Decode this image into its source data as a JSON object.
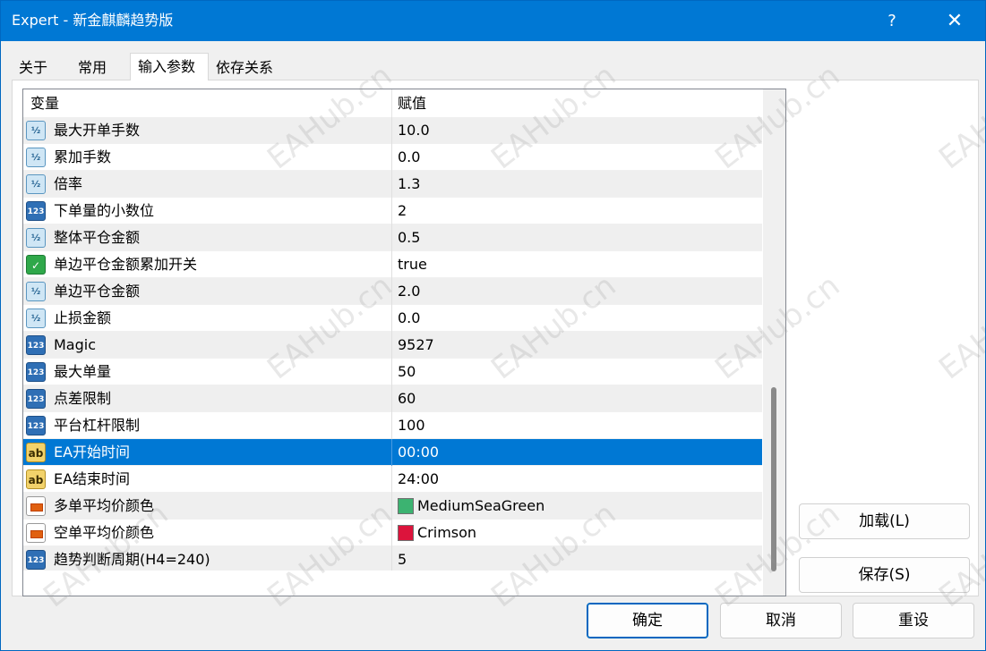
{
  "window": {
    "title": "Expert - 新金麒麟趋势版",
    "help_glyph": "?",
    "close_glyph": "✕"
  },
  "tabs": [
    {
      "label": "关于"
    },
    {
      "label": "常用"
    },
    {
      "label": "输入参数"
    },
    {
      "label": "依存关系"
    }
  ],
  "grid": {
    "header_variable": "变量",
    "header_value": "赋值",
    "rows": [
      {
        "icon": "double-icon",
        "icon_text": "½",
        "name": "最大开单手数",
        "value": "10.0"
      },
      {
        "icon": "double-icon",
        "icon_text": "½",
        "name": "累加手数",
        "value": "0.0"
      },
      {
        "icon": "double-icon",
        "icon_text": "½",
        "name": "倍率",
        "value": "1.3"
      },
      {
        "icon": "integer-icon",
        "icon_text": "123",
        "name": "下单量的小数位",
        "value": "2"
      },
      {
        "icon": "double-icon",
        "icon_text": "½",
        "name": "整体平仓金额",
        "value": "0.5"
      },
      {
        "icon": "bool-icon",
        "icon_text": "✓",
        "name": "单边平仓金额累加开关",
        "value": "true"
      },
      {
        "icon": "double-icon",
        "icon_text": "½",
        "name": "单边平仓金额",
        "value": "2.0"
      },
      {
        "icon": "double-icon",
        "icon_text": "½",
        "name": "止损金额",
        "value": "0.0"
      },
      {
        "icon": "integer-icon",
        "icon_text": "123",
        "name": "Magic",
        "value": "9527"
      },
      {
        "icon": "integer-icon",
        "icon_text": "123",
        "name": "最大单量",
        "value": "50"
      },
      {
        "icon": "integer-icon",
        "icon_text": "123",
        "name": "点差限制",
        "value": "60"
      },
      {
        "icon": "integer-icon",
        "icon_text": "123",
        "name": "平台杠杆限制",
        "value": "100"
      },
      {
        "icon": "string-icon",
        "icon_text": "ab",
        "name": "EA开始时间",
        "value": "00:00",
        "selected": true
      },
      {
        "icon": "string-icon",
        "icon_text": "ab",
        "name": "EA结束时间",
        "value": "24:00"
      },
      {
        "icon": "color-icon",
        "icon_text": "",
        "name": "多单平均价颜色",
        "value": "MediumSeaGreen",
        "swatch": "#3cb371"
      },
      {
        "icon": "color-icon",
        "icon_text": "",
        "name": "空单平均价颜色",
        "value": "Crimson",
        "swatch": "#dc143c"
      },
      {
        "icon": "integer-icon",
        "icon_text": "123",
        "name": "趋势判断周期(H4=240)",
        "value": "5"
      }
    ]
  },
  "buttons": {
    "load": "加载(L)",
    "save": "保存(S)",
    "ok": "确定",
    "cancel": "取消",
    "reset": "重设"
  },
  "watermark": "EAHub.cn",
  "colors": {
    "titlebar": "#0078d4",
    "selection": "#0078d4"
  }
}
